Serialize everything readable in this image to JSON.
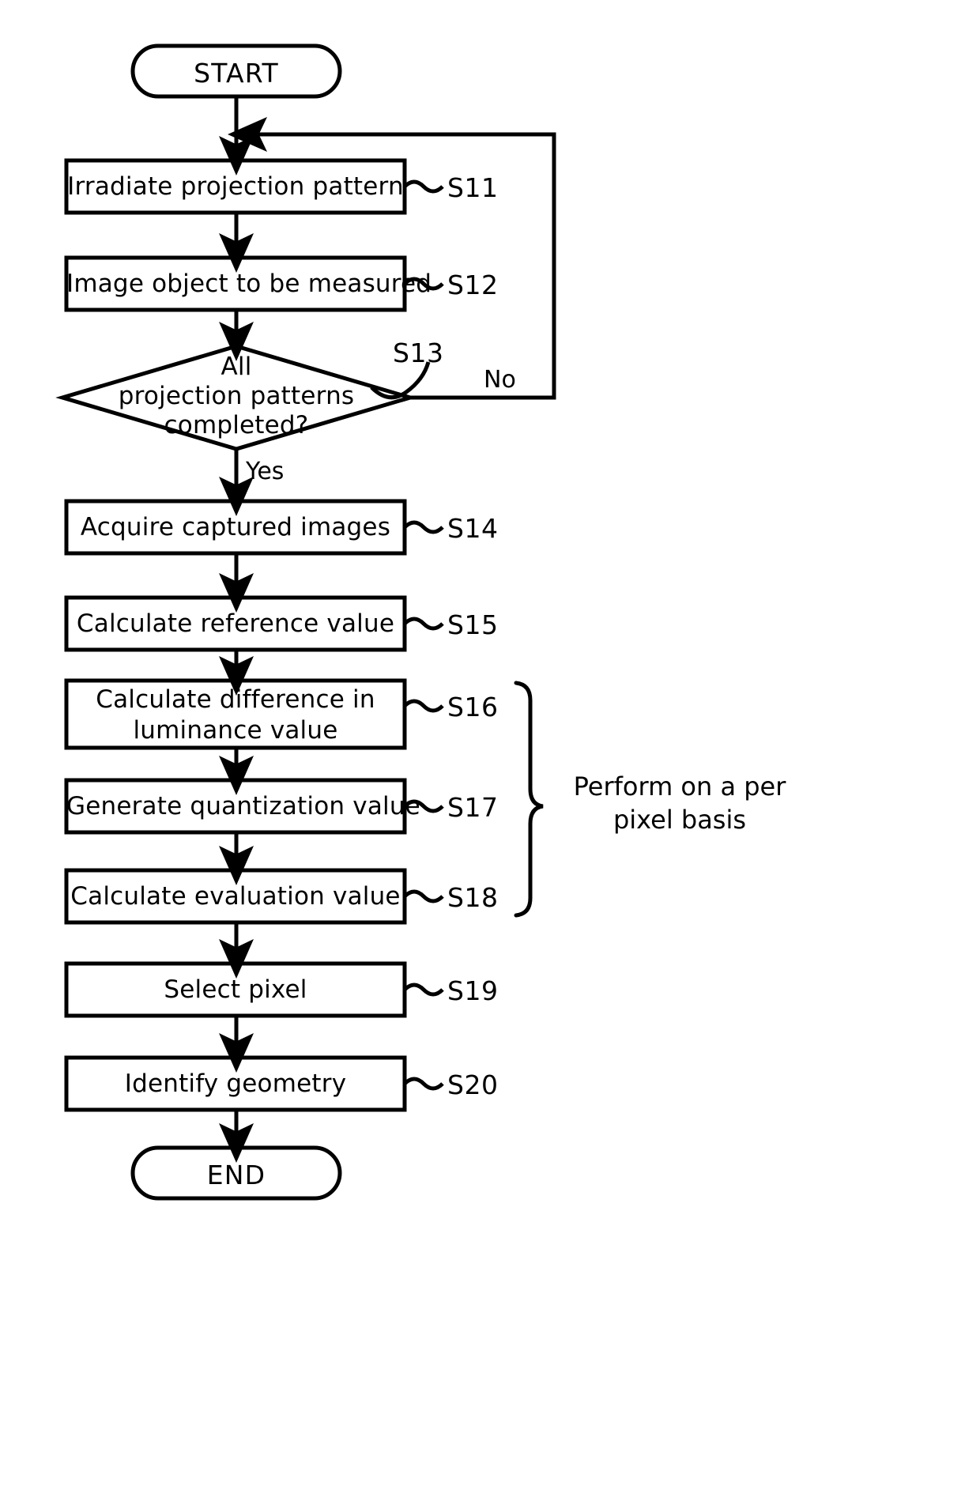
{
  "diagram": {
    "title": "Measurement procedure flowchart",
    "stroke_color": "#000000",
    "fill_color": "#ffffff",
    "background": "#ffffff"
  },
  "terminals": {
    "start": "START",
    "end": "END"
  },
  "steps": [
    {
      "id": "S11",
      "label": "Irradiate projection pattern",
      "ref": "S11"
    },
    {
      "id": "S12",
      "label": "Image object to be measured",
      "ref": "S12"
    },
    {
      "id": "S14",
      "label": "Acquire captured images",
      "ref": "S14"
    },
    {
      "id": "S15",
      "label": "Calculate reference value",
      "ref": "S15"
    },
    {
      "id": "S16",
      "label_line1": "Calculate difference in",
      "label_line2": "luminance value",
      "ref": "S16"
    },
    {
      "id": "S17",
      "label": "Generate quantization value",
      "ref": "S17"
    },
    {
      "id": "S18",
      "label": "Calculate evaluation value",
      "ref": "S18"
    },
    {
      "id": "S19",
      "label": "Select pixel",
      "ref": "S19"
    },
    {
      "id": "S20",
      "label": "Identify geometry",
      "ref": "S20"
    }
  ],
  "decision": {
    "id": "S13",
    "ref": "S13",
    "line1": "All",
    "line2": "projection patterns",
    "line3": "completed?",
    "yes_label": "Yes",
    "no_label": "No"
  },
  "annotation": {
    "line1": "Perform on a per",
    "line2": "pixel basis",
    "covers": [
      "S16",
      "S17",
      "S18"
    ]
  },
  "icons": {
    "arrowhead": "arrow-down-icon",
    "leader_squiggle": "squiggle-leader-icon",
    "brace": "curly-brace-icon"
  }
}
